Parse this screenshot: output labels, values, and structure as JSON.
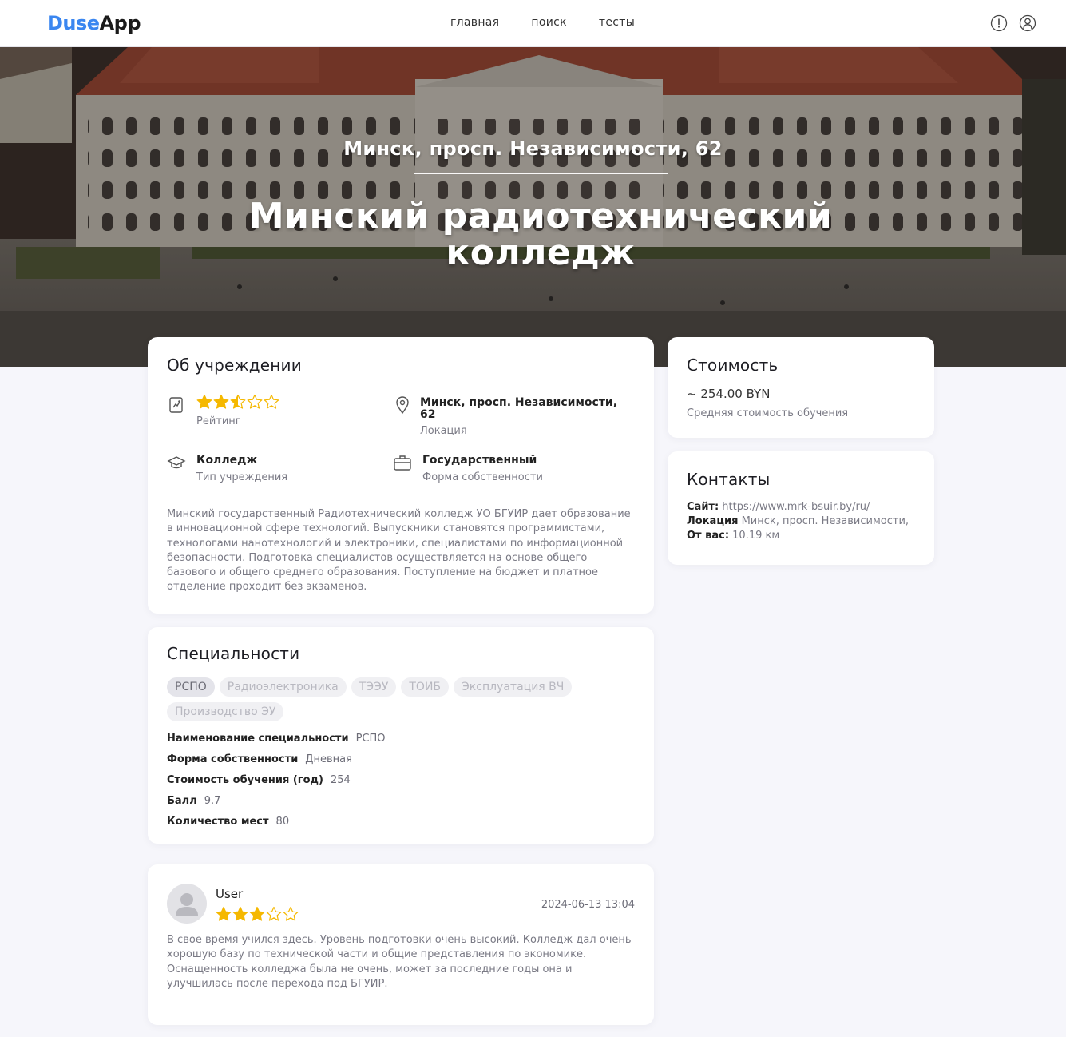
{
  "colors": {
    "accent": "#3a86f0",
    "star": "#f5b800",
    "muted": "#7a7a85"
  },
  "navbar": {
    "logo_part1": "Duse",
    "logo_part2": "App",
    "links": [
      "главная",
      "поиск",
      "тесты"
    ],
    "icons": [
      "info-icon",
      "user-icon"
    ]
  },
  "hero": {
    "address": "Минск, просп. Независимости, 62",
    "title": "Минский радиотехнический колледж"
  },
  "about": {
    "title": "Об учреждении",
    "rating": {
      "value": 2.5,
      "max": 5,
      "label": "Рейтинг"
    },
    "location": {
      "value": "Минск, просп. Независимости, 62",
      "label": "Локация"
    },
    "type": {
      "value": "Колледж",
      "label": "Тип учреждения"
    },
    "ownership": {
      "value": "Государственный",
      "label": "Форма собственности"
    },
    "description": "Минский государственный Радиотехнический колледж УО БГУИР дает образование в инновационной сфере технологий. Выпускники становятся программистами, технологами нанотехнологий и электроники, специалистами по информационной безопасности. Подготовка специалистов осуществляется на основе общего базового и общего среднего образования. Поступление на бюджет и платное отделение проходит без экзаменов."
  },
  "cost": {
    "title": "Стоимость",
    "value": "~ 254.00 BYN",
    "label": "Средняя стоимость обучения"
  },
  "contacts": {
    "title": "Контакты",
    "site_label": "Сайт:",
    "site_value": "https://www.mrk-bsuir.by/ru/",
    "location_label": "Локация",
    "location_value": "Минск, просп. Независимости,",
    "distance_label": "От вас:",
    "distance_value": "10.19 км"
  },
  "specialities": {
    "title": "Специальности",
    "chips": [
      "РСПО",
      "Радиоэлектроника",
      "ТЭЭУ",
      "ТОИБ",
      "Эксплуатация ВЧ",
      "Производство ЭУ"
    ],
    "active_index": 0,
    "details": [
      {
        "key": "Наименование специальности",
        "value": "РСПО"
      },
      {
        "key": "Форма собственности",
        "value": "Дневная"
      },
      {
        "key": "Стоимость обучения (год)",
        "value": "254"
      },
      {
        "key": "Балл",
        "value": "9.7"
      },
      {
        "key": "Количество мест",
        "value": "80"
      }
    ]
  },
  "review": {
    "user": "User",
    "rating": {
      "value": 3,
      "max": 5
    },
    "date": "2024-06-13 13:04",
    "text": "В свое время учился здесь. Уровень подготовки очень высокий. Колледж дал очень хорошую базу по технической части и общие представления по экономике. Оснащенность колледжа была не очень, может за последние годы она и улучшилась после перехода под БГУИР."
  }
}
